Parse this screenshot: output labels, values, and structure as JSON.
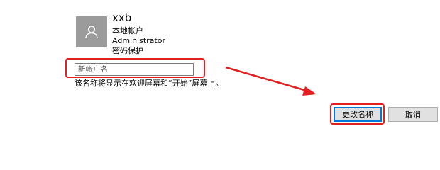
{
  "account": {
    "username": "xxb",
    "type": "本地帐户",
    "group": "Administrator",
    "protection": "密码保护"
  },
  "rename": {
    "placeholder": "新帐户名",
    "hint": "该名称将显示在欢迎屏幕和“开始”屏幕上。"
  },
  "buttons": {
    "rename": "更改名称",
    "cancel": "取消"
  },
  "icons": {
    "avatar": "user-icon"
  },
  "colors": {
    "highlight": "#e02020",
    "focus_border": "#0078d7",
    "avatar_bg": "#9b9b9b"
  }
}
